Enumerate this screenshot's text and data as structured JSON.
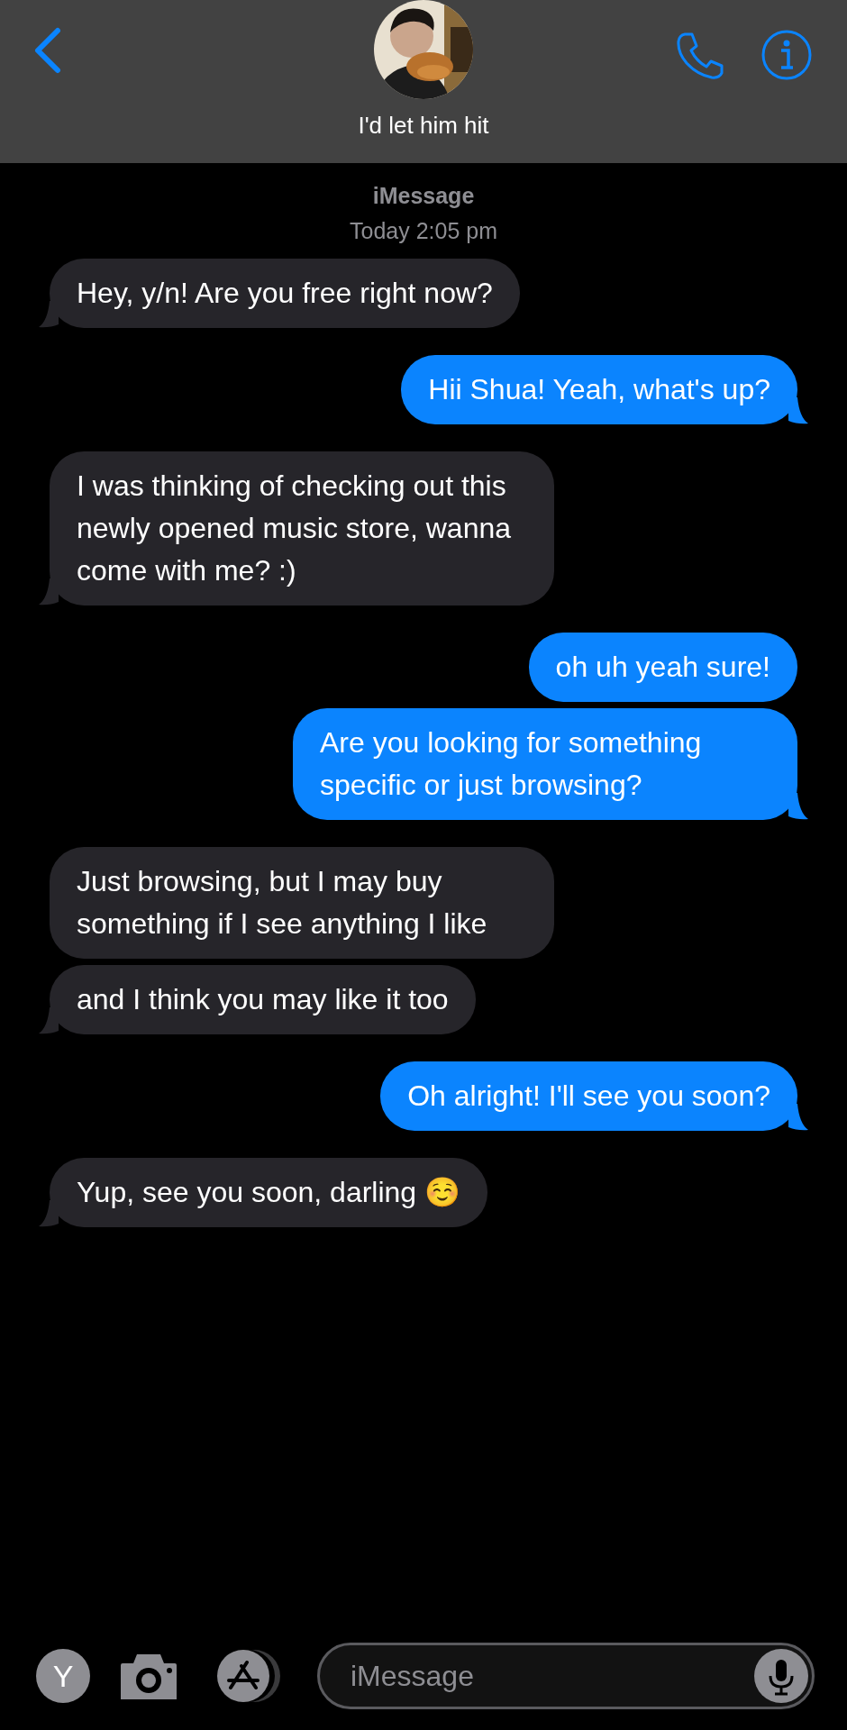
{
  "header": {
    "contact_name": "I'd let him hit"
  },
  "thread": {
    "service": "iMessage",
    "timestamp": "Today 2:05 pm"
  },
  "messages": [
    {
      "kind": "incoming",
      "text": "Hey, y/n! Are you free right now?",
      "tail": true
    },
    {
      "kind": "outgoing",
      "text": "Hii Shua! Yeah, what's up?",
      "tail": true
    },
    {
      "kind": "incoming",
      "text": "I was thinking of checking out this newly opened music store, wanna come with me? :)",
      "tail": true
    },
    {
      "kind": "outgoing",
      "text": "oh uh yeah sure!",
      "tail": false
    },
    {
      "kind": "outgoing",
      "text": "Are you looking for something specific or just browsing?",
      "tail": true
    },
    {
      "kind": "incoming",
      "text": "Just browsing, but I may buy something if I see anything I like",
      "tail": false
    },
    {
      "kind": "incoming",
      "text": "and I think you may like it too",
      "tail": true
    },
    {
      "kind": "outgoing",
      "text": "Oh alright! I'll see you soon?",
      "tail": true
    },
    {
      "kind": "incoming",
      "text": "Yup, see you soon, darling ☺️",
      "tail": true
    }
  ],
  "composer": {
    "avatar_letter": "Y",
    "placeholder": "iMessage"
  }
}
